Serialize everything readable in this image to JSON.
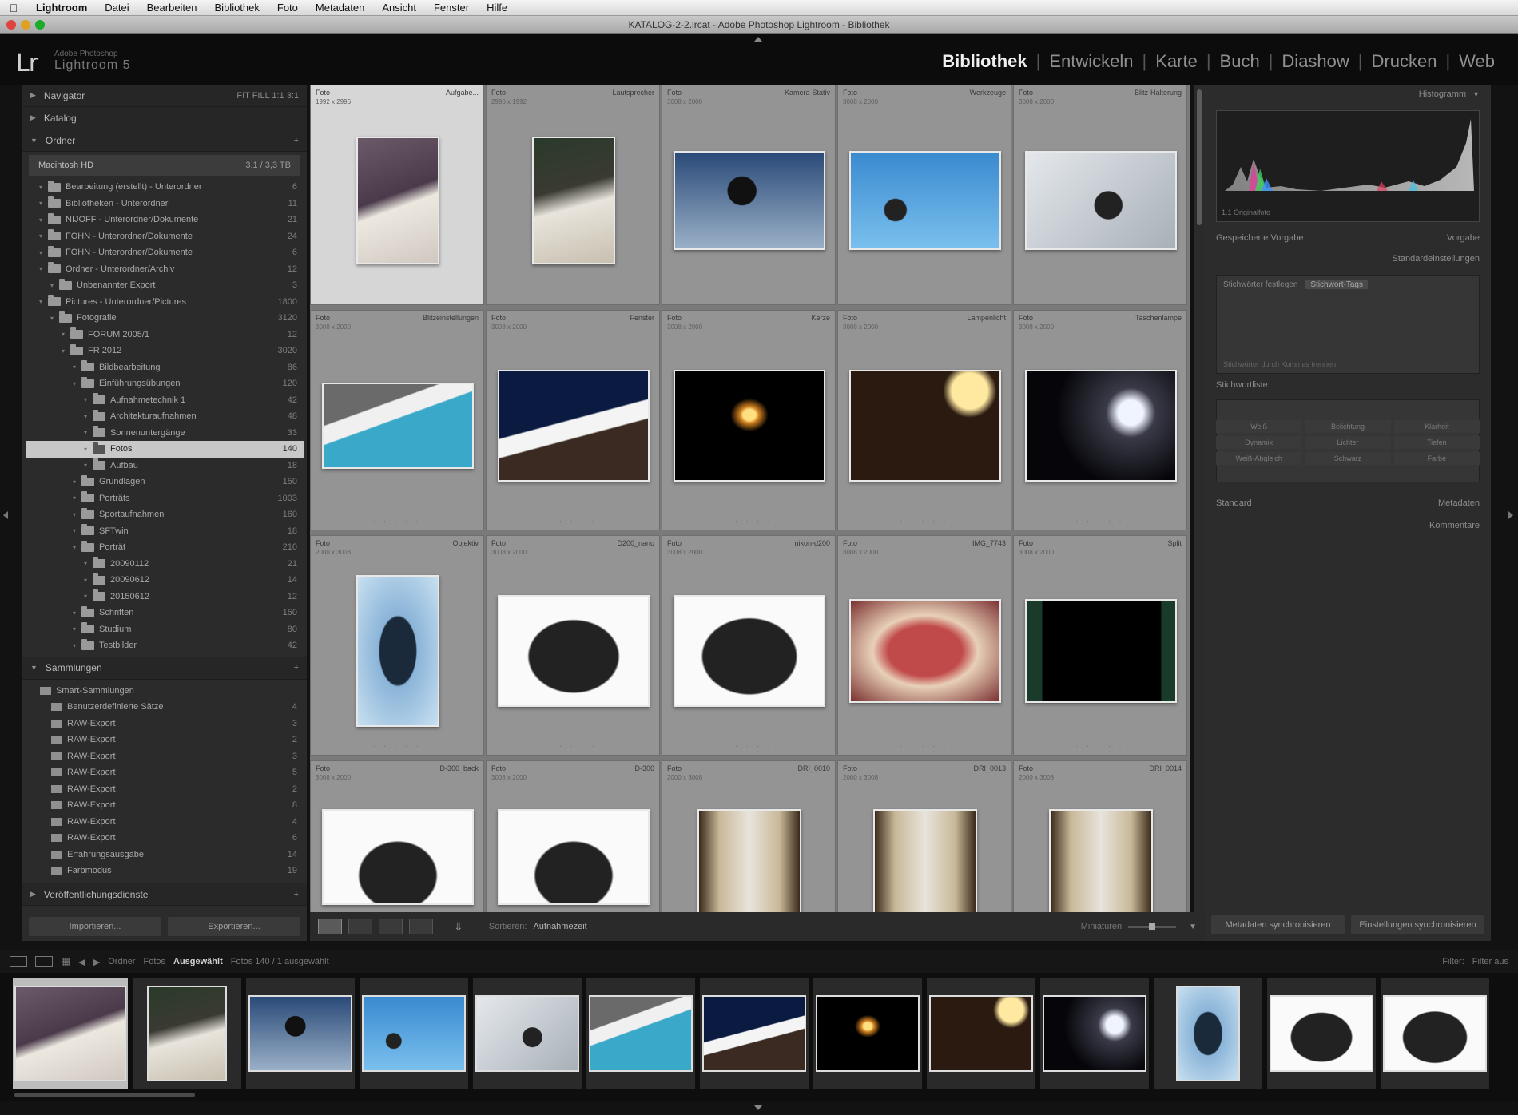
{
  "menubar": {
    "app": "Lightroom",
    "items": [
      "Datei",
      "Bearbeiten",
      "Bibliothek",
      "Foto",
      "Metadaten",
      "Ansicht",
      "Fenster",
      "Hilfe"
    ]
  },
  "window": {
    "title": "KATALOG-2-2.lrcat - Adobe Photoshop Lightroom - Bibliothek"
  },
  "identity": {
    "logo": "Lr",
    "line1": "Adobe Photoshop",
    "line2": "Lightroom 5"
  },
  "modules": [
    "Bibliothek",
    "Entwickeln",
    "Karte",
    "Buch",
    "Diashow",
    "Drucken",
    "Web"
  ],
  "leftpanel": {
    "navigator": {
      "label": "Navigator",
      "right": "FIT  FILL  1:1  3:1"
    },
    "catalog": {
      "label": "Katalog"
    },
    "folders": {
      "label": "Ordner"
    },
    "volume": {
      "name": "Macintosh HD",
      "info": "3,1 / 3,3 TB"
    },
    "folder_rows": [
      {
        "label": "Bearbeitung (erstellt) - Unterordner",
        "count": "6",
        "indent": 1
      },
      {
        "label": "Bibliotheken - Unterordner",
        "count": "11",
        "indent": 1
      },
      {
        "label": "NIJOFF - Unterordner/Dokumente",
        "count": "21",
        "indent": 1
      },
      {
        "label": "FOHN - Unterordner/Dokumente",
        "count": "24",
        "indent": 1
      },
      {
        "label": "FOHN - Unterordner/Dokumente",
        "count": "6",
        "indent": 1
      },
      {
        "label": "Ordner - Unterordner/Archiv",
        "count": "12",
        "indent": 1
      },
      {
        "label": "Unbenannter Export",
        "count": "3",
        "indent": 2
      },
      {
        "label": "Pictures - Unterordner/Pictures",
        "count": "1800",
        "indent": 1
      },
      {
        "label": "Fotografie",
        "count": "3120",
        "indent": 2
      },
      {
        "label": "FORUM 2005/1",
        "count": "12",
        "indent": 3
      },
      {
        "label": "FR 2012",
        "count": "3020",
        "indent": 3
      },
      {
        "label": "Bildbearbeitung",
        "count": "86",
        "indent": 4
      },
      {
        "label": "Einführungsübungen",
        "count": "120",
        "indent": 4
      },
      {
        "label": "Aufnahmetechnik 1",
        "count": "42",
        "indent": 5
      },
      {
        "label": "Architekturaufnahmen",
        "count": "48",
        "indent": 5
      },
      {
        "label": "Sonnenuntergänge",
        "count": "33",
        "indent": 5
      },
      {
        "label": "Fotos",
        "count": "140",
        "indent": 5,
        "selected": true
      },
      {
        "label": "Aufbau",
        "count": "18",
        "indent": 5
      },
      {
        "label": "Grundlagen",
        "count": "150",
        "indent": 4
      },
      {
        "label": "Porträts",
        "count": "1003",
        "indent": 4
      },
      {
        "label": "Sportaufnahmen",
        "count": "160",
        "indent": 4
      },
      {
        "label": "SFTwin",
        "count": "18",
        "indent": 4
      },
      {
        "label": "Porträt",
        "count": "210",
        "indent": 4
      },
      {
        "label": "20090112",
        "count": "21",
        "indent": 5
      },
      {
        "label": "20090612",
        "count": "14",
        "indent": 5
      },
      {
        "label": "20150612",
        "count": "12",
        "indent": 5
      },
      {
        "label": "Schriften",
        "count": "150",
        "indent": 4
      },
      {
        "label": "Studium",
        "count": "80",
        "indent": 4
      },
      {
        "label": "Testbilder",
        "count": "42",
        "indent": 4
      }
    ],
    "collections": {
      "label": "Sammlungen"
    },
    "collection_rows": [
      {
        "label": "Smart-Sammlungen",
        "count": ""
      },
      {
        "label": "Benutzerdefinierte Sätze",
        "count": "4"
      },
      {
        "label": "RAW-Export",
        "count": "3"
      },
      {
        "label": "RAW-Export",
        "count": "2"
      },
      {
        "label": "RAW-Export",
        "count": "3"
      },
      {
        "label": "RAW-Export",
        "count": "5"
      },
      {
        "label": "RAW-Export",
        "count": "2"
      },
      {
        "label": "RAW-Export",
        "count": "8"
      },
      {
        "label": "RAW-Export",
        "count": "4"
      },
      {
        "label": "RAW-Export",
        "count": "6"
      },
      {
        "label": "Erfahrungsausgabe",
        "count": "14"
      },
      {
        "label": "Farbmodus",
        "count": "19"
      }
    ],
    "publish": {
      "label": "Veröffentlichungsdienste"
    },
    "btn_import": "Importieren...",
    "btn_export": "Exportieren..."
  },
  "grid": {
    "cells": [
      {
        "idx": 1,
        "ext": "Foto",
        "name": "Aufgabe...",
        "sub": "1992 x 2996",
        "selected": true
      },
      {
        "idx": 2,
        "ext": "Foto",
        "name": "Lautsprecher",
        "sub": "2996 x 1992"
      },
      {
        "idx": 3,
        "ext": "Foto",
        "name": "Kamera-Stativ",
        "sub": "3008 x 2000"
      },
      {
        "idx": 4,
        "ext": "Foto",
        "name": "Werkzeuge",
        "sub": "3008 x 2000"
      },
      {
        "idx": 5,
        "ext": "Foto",
        "name": "Blitz-Halterung",
        "sub": "3008 x 2000"
      },
      {
        "idx": 6,
        "ext": "Foto",
        "name": "Blitzeinstellungen",
        "sub": "3008 x 2000"
      },
      {
        "idx": 7,
        "ext": "Foto",
        "name": "Fenster",
        "sub": "3008 x 2000"
      },
      {
        "idx": 8,
        "ext": "Foto",
        "name": "Kerze",
        "sub": "3008 x 2000"
      },
      {
        "idx": 9,
        "ext": "Foto",
        "name": "Lampenlicht",
        "sub": "3008 x 2000"
      },
      {
        "idx": 10,
        "ext": "Foto",
        "name": "Taschenlampe",
        "sub": "3008 x 2000"
      },
      {
        "idx": 11,
        "ext": "Foto",
        "name": "Objektiv",
        "sub": "2000 x 3008"
      },
      {
        "idx": 12,
        "ext": "Foto",
        "name": "D200_nano",
        "sub": "3008 x 2000"
      },
      {
        "idx": 13,
        "ext": "Foto",
        "name": "nikon-d200",
        "sub": "3008 x 2000"
      },
      {
        "idx": 14,
        "ext": "Foto",
        "name": "IMG_7743",
        "sub": "3008 x 2000"
      },
      {
        "idx": 15,
        "ext": "Foto",
        "name": "Split",
        "sub": "3008 x 2000"
      },
      {
        "idx": 16,
        "ext": "Foto",
        "name": "D-300_back",
        "sub": "3008 x 2000"
      },
      {
        "idx": 17,
        "ext": "Foto",
        "name": "D-300",
        "sub": "3008 x 2000"
      },
      {
        "idx": 18,
        "ext": "Foto",
        "name": "DRI_0010",
        "sub": "2000 x 3008"
      },
      {
        "idx": 19,
        "ext": "Foto",
        "name": "DRI_0013",
        "sub": "2000 x 3008"
      },
      {
        "idx": 20,
        "ext": "Foto",
        "name": "DRI_0014",
        "sub": "2000 x 3008"
      }
    ]
  },
  "toolbar": {
    "sort_label": "Sortieren:",
    "sort_value": "Aufnahmezeit",
    "thumbs_label": "Miniaturen"
  },
  "rightpanel": {
    "histogram": {
      "label": "Histogramm",
      "info": "1.1  Originalfoto"
    },
    "quick_develop": {
      "preset_label": "Gespeicherte Vorgabe",
      "preset_value": "Vorgabe",
      "defaults": "Standardeinstellungen"
    },
    "keywording": {
      "label": "Stichwörter festlegen",
      "value": "Stichwort-Tags",
      "tags": "Stichwörter durch Kommas trennen"
    },
    "keyword_list": {
      "label": "Stichwortliste"
    },
    "metadata": {
      "label": "Metadaten",
      "preset": "Standard"
    },
    "comments": {
      "label": "Kommentare"
    },
    "buttons": {
      "sync": "Metadaten synchronisieren",
      "sync2": "Einstellungen synchronisieren"
    },
    "wb_grid": [
      "Weiß",
      "Belichtung",
      "Klarheit",
      "Dynamik",
      "Lichter",
      "Tiefen",
      "Weiß-Abgleich",
      "Schwarz",
      "Farbe"
    ]
  },
  "filmstrip": {
    "crumbs": [
      "Ordner",
      "Fotos"
    ],
    "active": "Ausgewählt",
    "info": "Fotos 140 / 1 ausgewählt",
    "filter_label": "Filter:",
    "filter_value": "Filter aus"
  }
}
